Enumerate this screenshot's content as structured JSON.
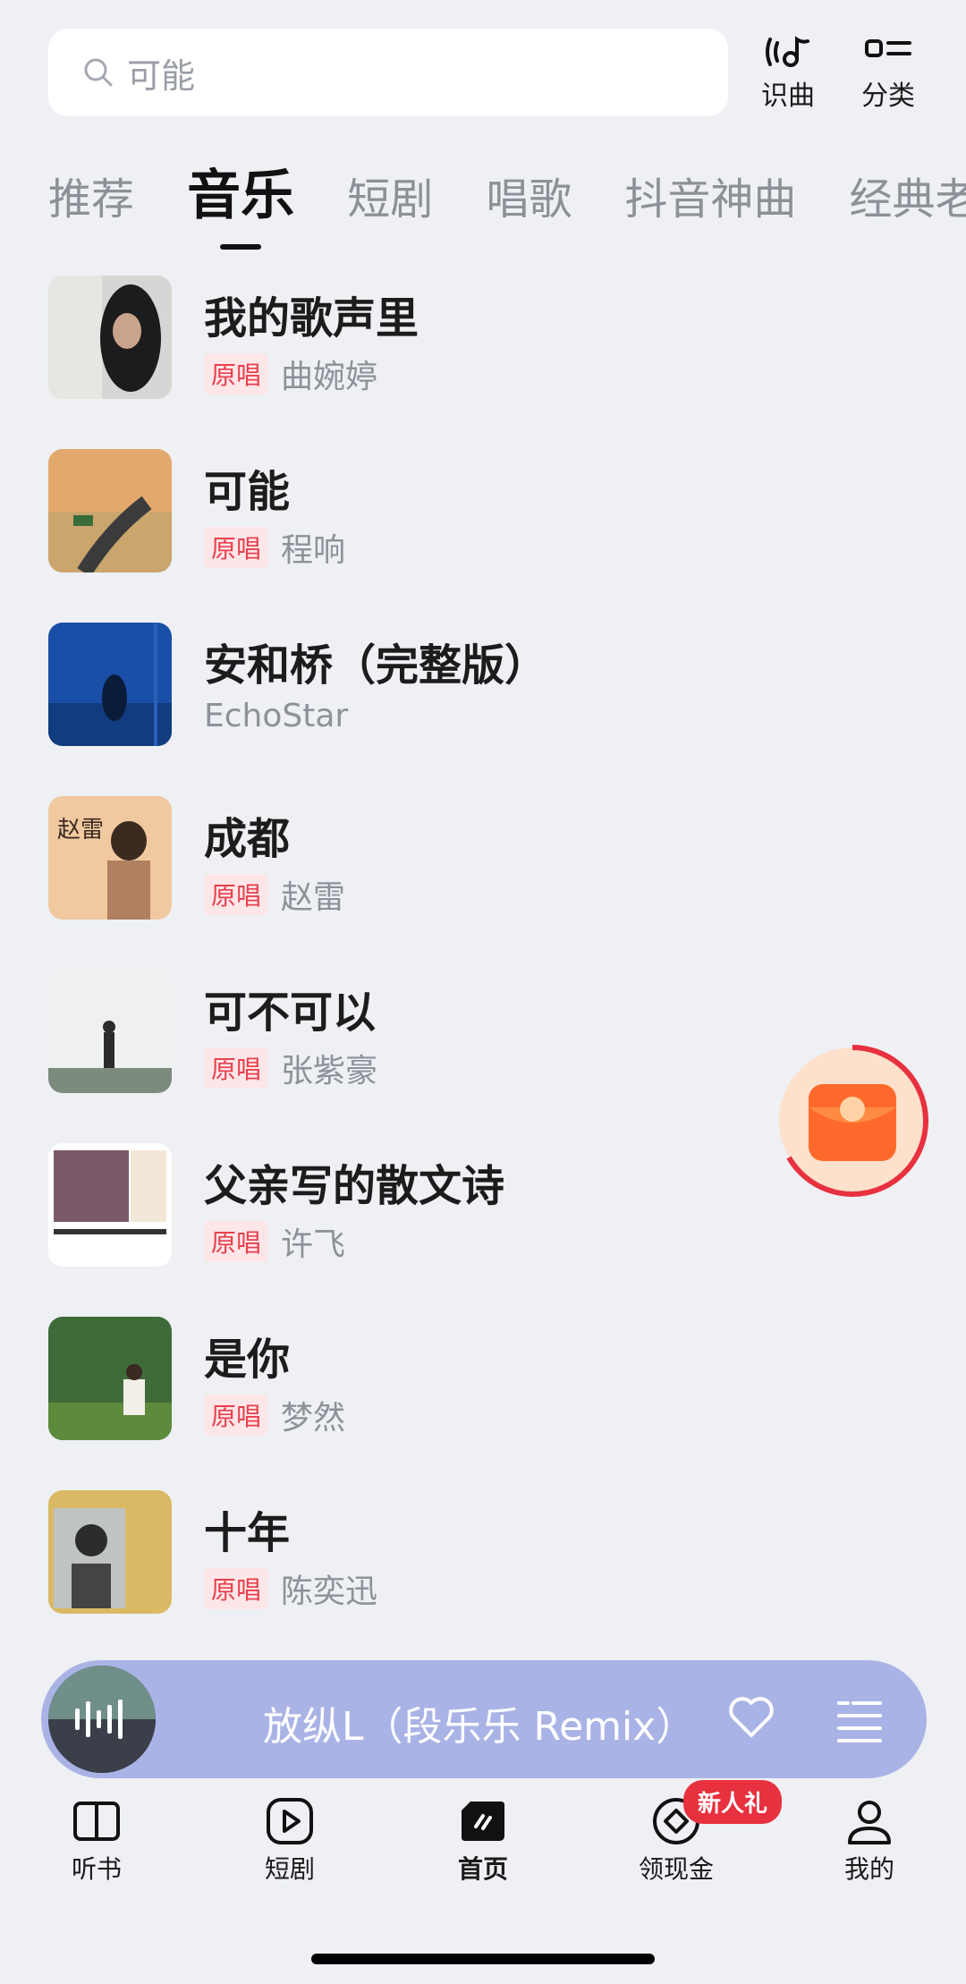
{
  "search": {
    "placeholder": "可能"
  },
  "top_actions": [
    {
      "label": "识曲",
      "icon": "music-recognize-icon"
    },
    {
      "label": "分类",
      "icon": "category-icon"
    }
  ],
  "tabs": [
    "推荐",
    "音乐",
    "短剧",
    "唱歌",
    "抖音神曲",
    "经典老"
  ],
  "active_tab": "音乐",
  "songs": [
    {
      "title": "我的歌声里",
      "badge": "原唱",
      "artist": "曲婉婷"
    },
    {
      "title": "可能",
      "badge": "原唱",
      "artist": "程响"
    },
    {
      "title": "安和桥（完整版）",
      "badge": "",
      "artist": "EchoStar"
    },
    {
      "title": "成都",
      "badge": "原唱",
      "artist": "赵雷"
    },
    {
      "title": "可不可以",
      "badge": "原唱",
      "artist": "张紫豪"
    },
    {
      "title": "父亲写的散文诗",
      "badge": "原唱",
      "artist": "许飞"
    },
    {
      "title": "是你",
      "badge": "原唱",
      "artist": "梦然"
    },
    {
      "title": "十年",
      "badge": "原唱",
      "artist": "陈奕迅"
    }
  ],
  "player": {
    "now_playing": "放纵L（段乐乐 Remix）"
  },
  "nav": [
    {
      "label": "听书",
      "icon": "book-icon"
    },
    {
      "label": "短剧",
      "icon": "play-icon"
    },
    {
      "label": "首页",
      "icon": "home-logo-icon"
    },
    {
      "label": "领现金",
      "icon": "coin-icon"
    },
    {
      "label": "我的",
      "icon": "profile-icon"
    }
  ],
  "nav_badge": "新人礼",
  "colors": {
    "accent_red": "#e8404d",
    "player_bg": "#aab3e5",
    "page_bg": "#eef0f4"
  }
}
